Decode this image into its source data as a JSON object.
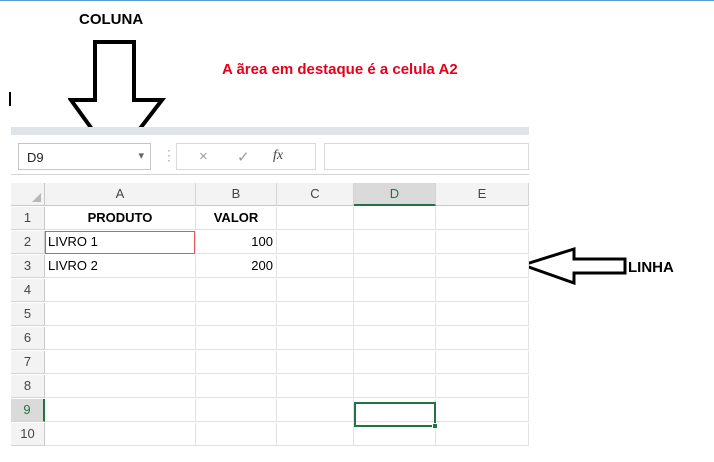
{
  "annotations": {
    "coluna": "COLUNA",
    "linha": "LINHA",
    "destaque": "A ãrea em destaque é a celula A2"
  },
  "colors": {
    "accent_green": "#217346",
    "highlight_red": "#e5001c",
    "a2_border": "#e05a5a"
  },
  "excel": {
    "name_box": "D9",
    "formula_bar": {
      "cancel_icon": "×",
      "enter_icon": "✓",
      "fx_label": "fx",
      "value": ""
    },
    "active_cell": "D9",
    "highlighted_cell": "A2",
    "columns": [
      "A",
      "B",
      "C",
      "D",
      "E"
    ],
    "rows": [
      {
        "num": "1",
        "cells": [
          "PRODUTO",
          "VALOR",
          "",
          "",
          ""
        ]
      },
      {
        "num": "2",
        "cells": [
          "LIVRO 1",
          "100",
          "",
          "",
          ""
        ]
      },
      {
        "num": "3",
        "cells": [
          "LIVRO 2",
          "200",
          "",
          "",
          ""
        ]
      },
      {
        "num": "4",
        "cells": [
          "",
          "",
          "",
          "",
          ""
        ]
      },
      {
        "num": "5",
        "cells": [
          "",
          "",
          "",
          "",
          ""
        ]
      },
      {
        "num": "6",
        "cells": [
          "",
          "",
          "",
          "",
          ""
        ]
      },
      {
        "num": "7",
        "cells": [
          "",
          "",
          "",
          "",
          ""
        ]
      },
      {
        "num": "8",
        "cells": [
          "",
          "",
          "",
          "",
          ""
        ]
      },
      {
        "num": "9",
        "cells": [
          "",
          "",
          "",
          "",
          ""
        ]
      },
      {
        "num": "10",
        "cells": [
          "",
          "",
          "",
          "",
          ""
        ]
      }
    ]
  }
}
